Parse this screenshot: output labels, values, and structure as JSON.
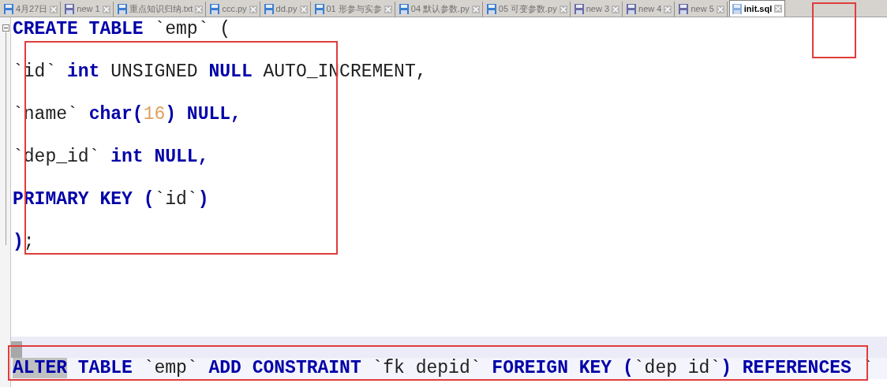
{
  "tabs": [
    {
      "label": "4月27日",
      "color": "#3a7fd0",
      "selected": false
    },
    {
      "label": "new 1",
      "color": "#6a6aa8",
      "selected": false
    },
    {
      "label": "重点知识归纳.txt",
      "color": "#3a7fd0",
      "selected": false
    },
    {
      "label": "ccc.py",
      "color": "#3a7fd0",
      "selected": false
    },
    {
      "label": "dd.py",
      "color": "#3a7fd0",
      "selected": false
    },
    {
      "label": "01 形参与实参",
      "color": "#3a7fd0",
      "selected": false
    },
    {
      "label": "04 默认参数.py",
      "color": "#3a7fd0",
      "selected": false
    },
    {
      "label": "05 可变参数.py",
      "color": "#3a7fd0",
      "selected": false
    },
    {
      "label": "new 3",
      "color": "#6a6aa8",
      "selected": false
    },
    {
      "label": "new 4",
      "color": "#6a6aa8",
      "selected": false
    },
    {
      "label": "new 5",
      "color": "#6a6aa8",
      "selected": false
    },
    {
      "label": "init.sql",
      "color": "#8ab0e0",
      "selected": true
    }
  ],
  "statements": [
    {
      "lines": [
        {
          "tokens": [
            {
              "text": "CREATE TABLE",
              "kind": "keyword"
            },
            {
              "text": " `emp` (",
              "kind": "plain"
            }
          ]
        },
        {
          "tokens": [
            {
              "text": "`id` ",
              "kind": "plain"
            },
            {
              "text": "int",
              "kind": "keyword"
            },
            {
              "text": " UNSIGNED ",
              "kind": "plain"
            },
            {
              "text": "NULL",
              "kind": "keyword"
            },
            {
              "text": " AUTO_INCREMENT,",
              "kind": "plain"
            }
          ]
        },
        {
          "tokens": [
            {
              "text": "`name` ",
              "kind": "plain"
            },
            {
              "text": "char(",
              "kind": "keyword"
            },
            {
              "text": "16",
              "kind": "number"
            },
            {
              "text": ") NULL,",
              "kind": "keyword"
            }
          ]
        },
        {
          "tokens": [
            {
              "text": "`dep_id` ",
              "kind": "plain"
            },
            {
              "text": "int NULL,",
              "kind": "keyword"
            }
          ]
        },
        {
          "tokens": [
            {
              "text": "PRIMARY KEY (",
              "kind": "keyword"
            },
            {
              "text": "`id`",
              "kind": "plain"
            },
            {
              "text": ")",
              "kind": "keyword"
            }
          ]
        },
        {
          "tokens": [
            {
              "text": ")",
              "kind": "keyword"
            },
            {
              "text": ";",
              "kind": "plain"
            }
          ]
        }
      ]
    },
    {
      "lines": [
        {
          "tokens": [
            {
              "text": "ALTER",
              "kind": "keyword",
              "highlighted": true
            },
            {
              "text": " TABLE",
              "kind": "keyword"
            },
            {
              "text": " `emp` ",
              "kind": "plain"
            },
            {
              "text": "ADD CONSTRAINT",
              "kind": "keyword"
            },
            {
              "text": " `fk depid` ",
              "kind": "plain"
            },
            {
              "text": "FOREIGN KEY (",
              "kind": "keyword"
            },
            {
              "text": "`dep id`",
              "kind": "plain"
            },
            {
              "text": ") REFERENCES",
              "kind": "keyword"
            },
            {
              "text": " `",
              "kind": "plain"
            }
          ]
        }
      ]
    }
  ]
}
